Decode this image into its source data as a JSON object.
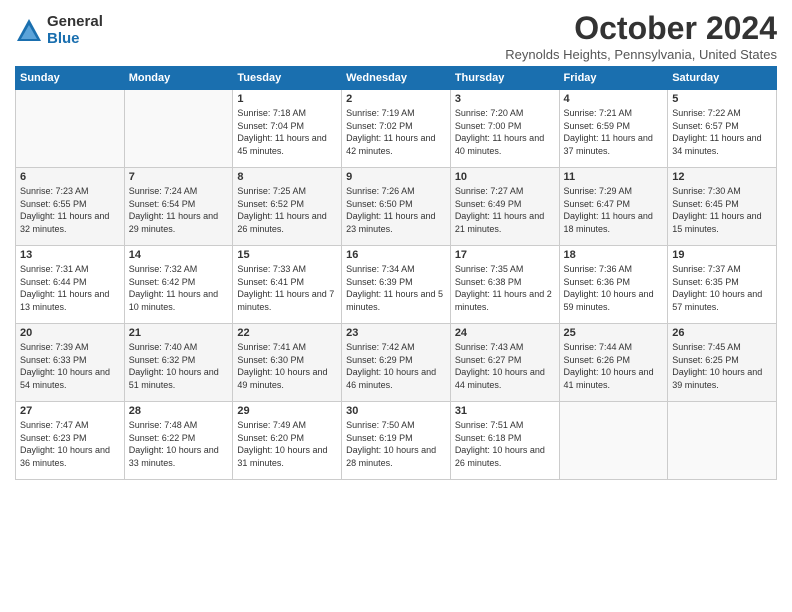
{
  "logo": {
    "general": "General",
    "blue": "Blue"
  },
  "header": {
    "month": "October 2024",
    "location": "Reynolds Heights, Pennsylvania, United States"
  },
  "weekdays": [
    "Sunday",
    "Monday",
    "Tuesday",
    "Wednesday",
    "Thursday",
    "Friday",
    "Saturday"
  ],
  "weeks": [
    [
      {
        "day": "",
        "info": ""
      },
      {
        "day": "",
        "info": ""
      },
      {
        "day": "1",
        "info": "Sunrise: 7:18 AM\nSunset: 7:04 PM\nDaylight: 11 hours and 45 minutes."
      },
      {
        "day": "2",
        "info": "Sunrise: 7:19 AM\nSunset: 7:02 PM\nDaylight: 11 hours and 42 minutes."
      },
      {
        "day": "3",
        "info": "Sunrise: 7:20 AM\nSunset: 7:00 PM\nDaylight: 11 hours and 40 minutes."
      },
      {
        "day": "4",
        "info": "Sunrise: 7:21 AM\nSunset: 6:59 PM\nDaylight: 11 hours and 37 minutes."
      },
      {
        "day": "5",
        "info": "Sunrise: 7:22 AM\nSunset: 6:57 PM\nDaylight: 11 hours and 34 minutes."
      }
    ],
    [
      {
        "day": "6",
        "info": "Sunrise: 7:23 AM\nSunset: 6:55 PM\nDaylight: 11 hours and 32 minutes."
      },
      {
        "day": "7",
        "info": "Sunrise: 7:24 AM\nSunset: 6:54 PM\nDaylight: 11 hours and 29 minutes."
      },
      {
        "day": "8",
        "info": "Sunrise: 7:25 AM\nSunset: 6:52 PM\nDaylight: 11 hours and 26 minutes."
      },
      {
        "day": "9",
        "info": "Sunrise: 7:26 AM\nSunset: 6:50 PM\nDaylight: 11 hours and 23 minutes."
      },
      {
        "day": "10",
        "info": "Sunrise: 7:27 AM\nSunset: 6:49 PM\nDaylight: 11 hours and 21 minutes."
      },
      {
        "day": "11",
        "info": "Sunrise: 7:29 AM\nSunset: 6:47 PM\nDaylight: 11 hours and 18 minutes."
      },
      {
        "day": "12",
        "info": "Sunrise: 7:30 AM\nSunset: 6:45 PM\nDaylight: 11 hours and 15 minutes."
      }
    ],
    [
      {
        "day": "13",
        "info": "Sunrise: 7:31 AM\nSunset: 6:44 PM\nDaylight: 11 hours and 13 minutes."
      },
      {
        "day": "14",
        "info": "Sunrise: 7:32 AM\nSunset: 6:42 PM\nDaylight: 11 hours and 10 minutes."
      },
      {
        "day": "15",
        "info": "Sunrise: 7:33 AM\nSunset: 6:41 PM\nDaylight: 11 hours and 7 minutes."
      },
      {
        "day": "16",
        "info": "Sunrise: 7:34 AM\nSunset: 6:39 PM\nDaylight: 11 hours and 5 minutes."
      },
      {
        "day": "17",
        "info": "Sunrise: 7:35 AM\nSunset: 6:38 PM\nDaylight: 11 hours and 2 minutes."
      },
      {
        "day": "18",
        "info": "Sunrise: 7:36 AM\nSunset: 6:36 PM\nDaylight: 10 hours and 59 minutes."
      },
      {
        "day": "19",
        "info": "Sunrise: 7:37 AM\nSunset: 6:35 PM\nDaylight: 10 hours and 57 minutes."
      }
    ],
    [
      {
        "day": "20",
        "info": "Sunrise: 7:39 AM\nSunset: 6:33 PM\nDaylight: 10 hours and 54 minutes."
      },
      {
        "day": "21",
        "info": "Sunrise: 7:40 AM\nSunset: 6:32 PM\nDaylight: 10 hours and 51 minutes."
      },
      {
        "day": "22",
        "info": "Sunrise: 7:41 AM\nSunset: 6:30 PM\nDaylight: 10 hours and 49 minutes."
      },
      {
        "day": "23",
        "info": "Sunrise: 7:42 AM\nSunset: 6:29 PM\nDaylight: 10 hours and 46 minutes."
      },
      {
        "day": "24",
        "info": "Sunrise: 7:43 AM\nSunset: 6:27 PM\nDaylight: 10 hours and 44 minutes."
      },
      {
        "day": "25",
        "info": "Sunrise: 7:44 AM\nSunset: 6:26 PM\nDaylight: 10 hours and 41 minutes."
      },
      {
        "day": "26",
        "info": "Sunrise: 7:45 AM\nSunset: 6:25 PM\nDaylight: 10 hours and 39 minutes."
      }
    ],
    [
      {
        "day": "27",
        "info": "Sunrise: 7:47 AM\nSunset: 6:23 PM\nDaylight: 10 hours and 36 minutes."
      },
      {
        "day": "28",
        "info": "Sunrise: 7:48 AM\nSunset: 6:22 PM\nDaylight: 10 hours and 33 minutes."
      },
      {
        "day": "29",
        "info": "Sunrise: 7:49 AM\nSunset: 6:20 PM\nDaylight: 10 hours and 31 minutes."
      },
      {
        "day": "30",
        "info": "Sunrise: 7:50 AM\nSunset: 6:19 PM\nDaylight: 10 hours and 28 minutes."
      },
      {
        "day": "31",
        "info": "Sunrise: 7:51 AM\nSunset: 6:18 PM\nDaylight: 10 hours and 26 minutes."
      },
      {
        "day": "",
        "info": ""
      },
      {
        "day": "",
        "info": ""
      }
    ]
  ]
}
